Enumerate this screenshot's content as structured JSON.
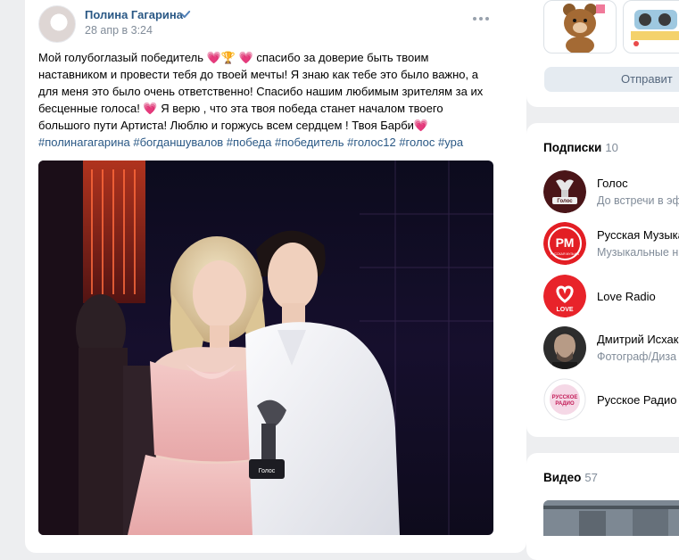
{
  "post": {
    "author": "Полина Гагарина",
    "date": "28 апр в 3:24",
    "text_lines": [
      "Мой голубоглазый победитель 💗🏆 💗 спасибо за доверие быть твоим",
      "наставником и провести тебя до твоей мечты! Я знаю как тебе это было важно, а",
      "для меня это было очень ответственно! Спасибо нашим любимым зрителям за их",
      "бесценные голоса! 💗 Я верю , что эта твоя победа станет началом твоего",
      "большого пути Артиста! Люблю и горжусь всем сердцем ! Твоя Барби💗"
    ],
    "hashtags": "#полинагагарина #богданшувалов #победа #победитель #голос12 #голос #ура"
  },
  "gifts": {
    "send_label": "Отправит"
  },
  "subscriptions": {
    "title": "Подписки",
    "count": "10",
    "items": [
      {
        "name": "Голос",
        "desc": "До встречи в эф"
      },
      {
        "name": "Русская Музыка",
        "desc": "Музыкальные н"
      },
      {
        "name": "Love Radio",
        "desc": ""
      },
      {
        "name": "Дмитрий Исхак",
        "desc": "Фотограф/Диза"
      },
      {
        "name": "Русское Радио",
        "desc": ""
      }
    ]
  },
  "videos": {
    "title": "Видео",
    "count": "57"
  },
  "logos": {
    "golos": "Голос",
    "rm_big": "РМ",
    "rm_small": "РУССКАЯ МУЗЫКА",
    "love": "LOVE",
    "rr_line1": "РУССКОЕ",
    "rr_line2": "РАДИО",
    "trophy": "Голос"
  },
  "colors": {
    "link": "#2a5885",
    "muted": "#818c99",
    "background": "#edeef0",
    "love_radio": "#e8232a"
  }
}
